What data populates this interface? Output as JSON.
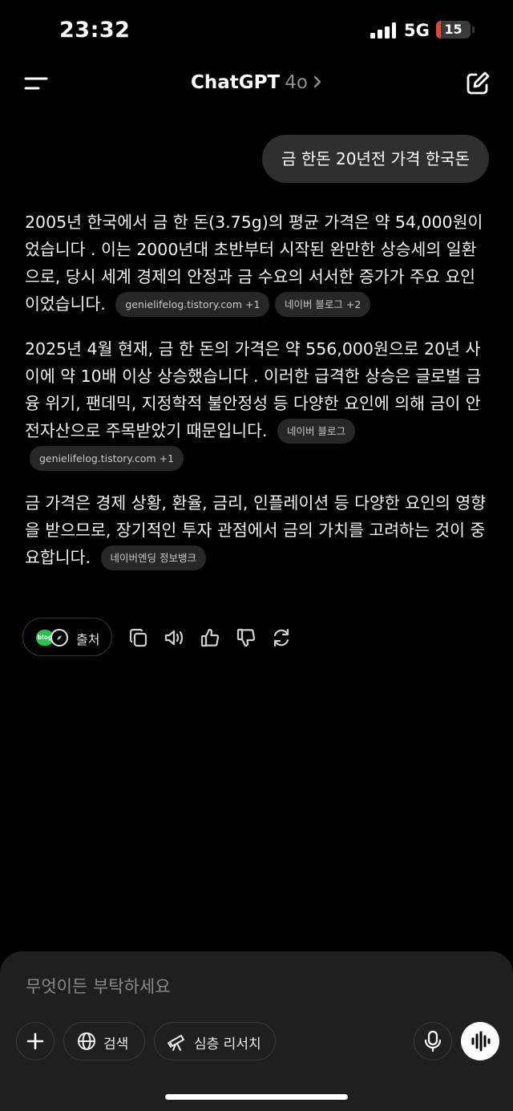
{
  "status_bar": {
    "time": "23:32",
    "network": "5G",
    "battery": "15",
    "battery_level_percent": 15,
    "battery_color": "#e5443a"
  },
  "header": {
    "title": "ChatGPT",
    "model": "4o",
    "menu_icon": "menu-icon",
    "new_chat_icon": "edit-icon"
  },
  "conversation": {
    "user_message": "금 한돈 20년전 가격 한국돈",
    "paragraphs": [
      {
        "text": "2005년 한국에서 금 한 돈(3.75g)의 평균 가격은 약 54,000원이었습니다 . 이는 2000년대 초반부터 시작된 완만한 상승세의 일환으로, 당시 세계 경제의 안정과 금 수요의 서서한 증가가 주요 요인이었습니다.",
        "sources": [
          "genielifelog.tistory.com +1",
          "네이버 블로그 +2"
        ]
      },
      {
        "text": "2025년 4월 현재, 금 한 돈의 가격은 약 556,000원으로 20년 사이에 약 10배 이상 상승했습니다 . 이러한 급격한 상승은 글로벌 금융 위기, 팬데믹, 지정학적 불안정성 등 다양한 요인에 의해 금이 안전자산으로 주목받았기 때문입니다.",
        "sources": [
          "네이버 블로그",
          "genielifelog.tistory.com +1"
        ]
      },
      {
        "text": "금 가격은 경제 상황, 환율, 금리, 인플레이션 등 다양한 요인의 영향을 받으므로, 장기적인 투자 관점에서 금의 가치를 고려하는 것이 중요합니다.",
        "sources": [
          "네이버엔딩 정보뱅크"
        ]
      }
    ]
  },
  "actions": {
    "sources_label": "출처",
    "blog_badge": "blog",
    "icons": [
      "copy-icon",
      "read-aloud-icon",
      "thumbs-up-icon",
      "thumbs-down-icon",
      "regenerate-icon"
    ]
  },
  "composer": {
    "placeholder": "무엇이든 부탁하세요",
    "search_label": "검색",
    "research_label": "심층 리서치"
  }
}
